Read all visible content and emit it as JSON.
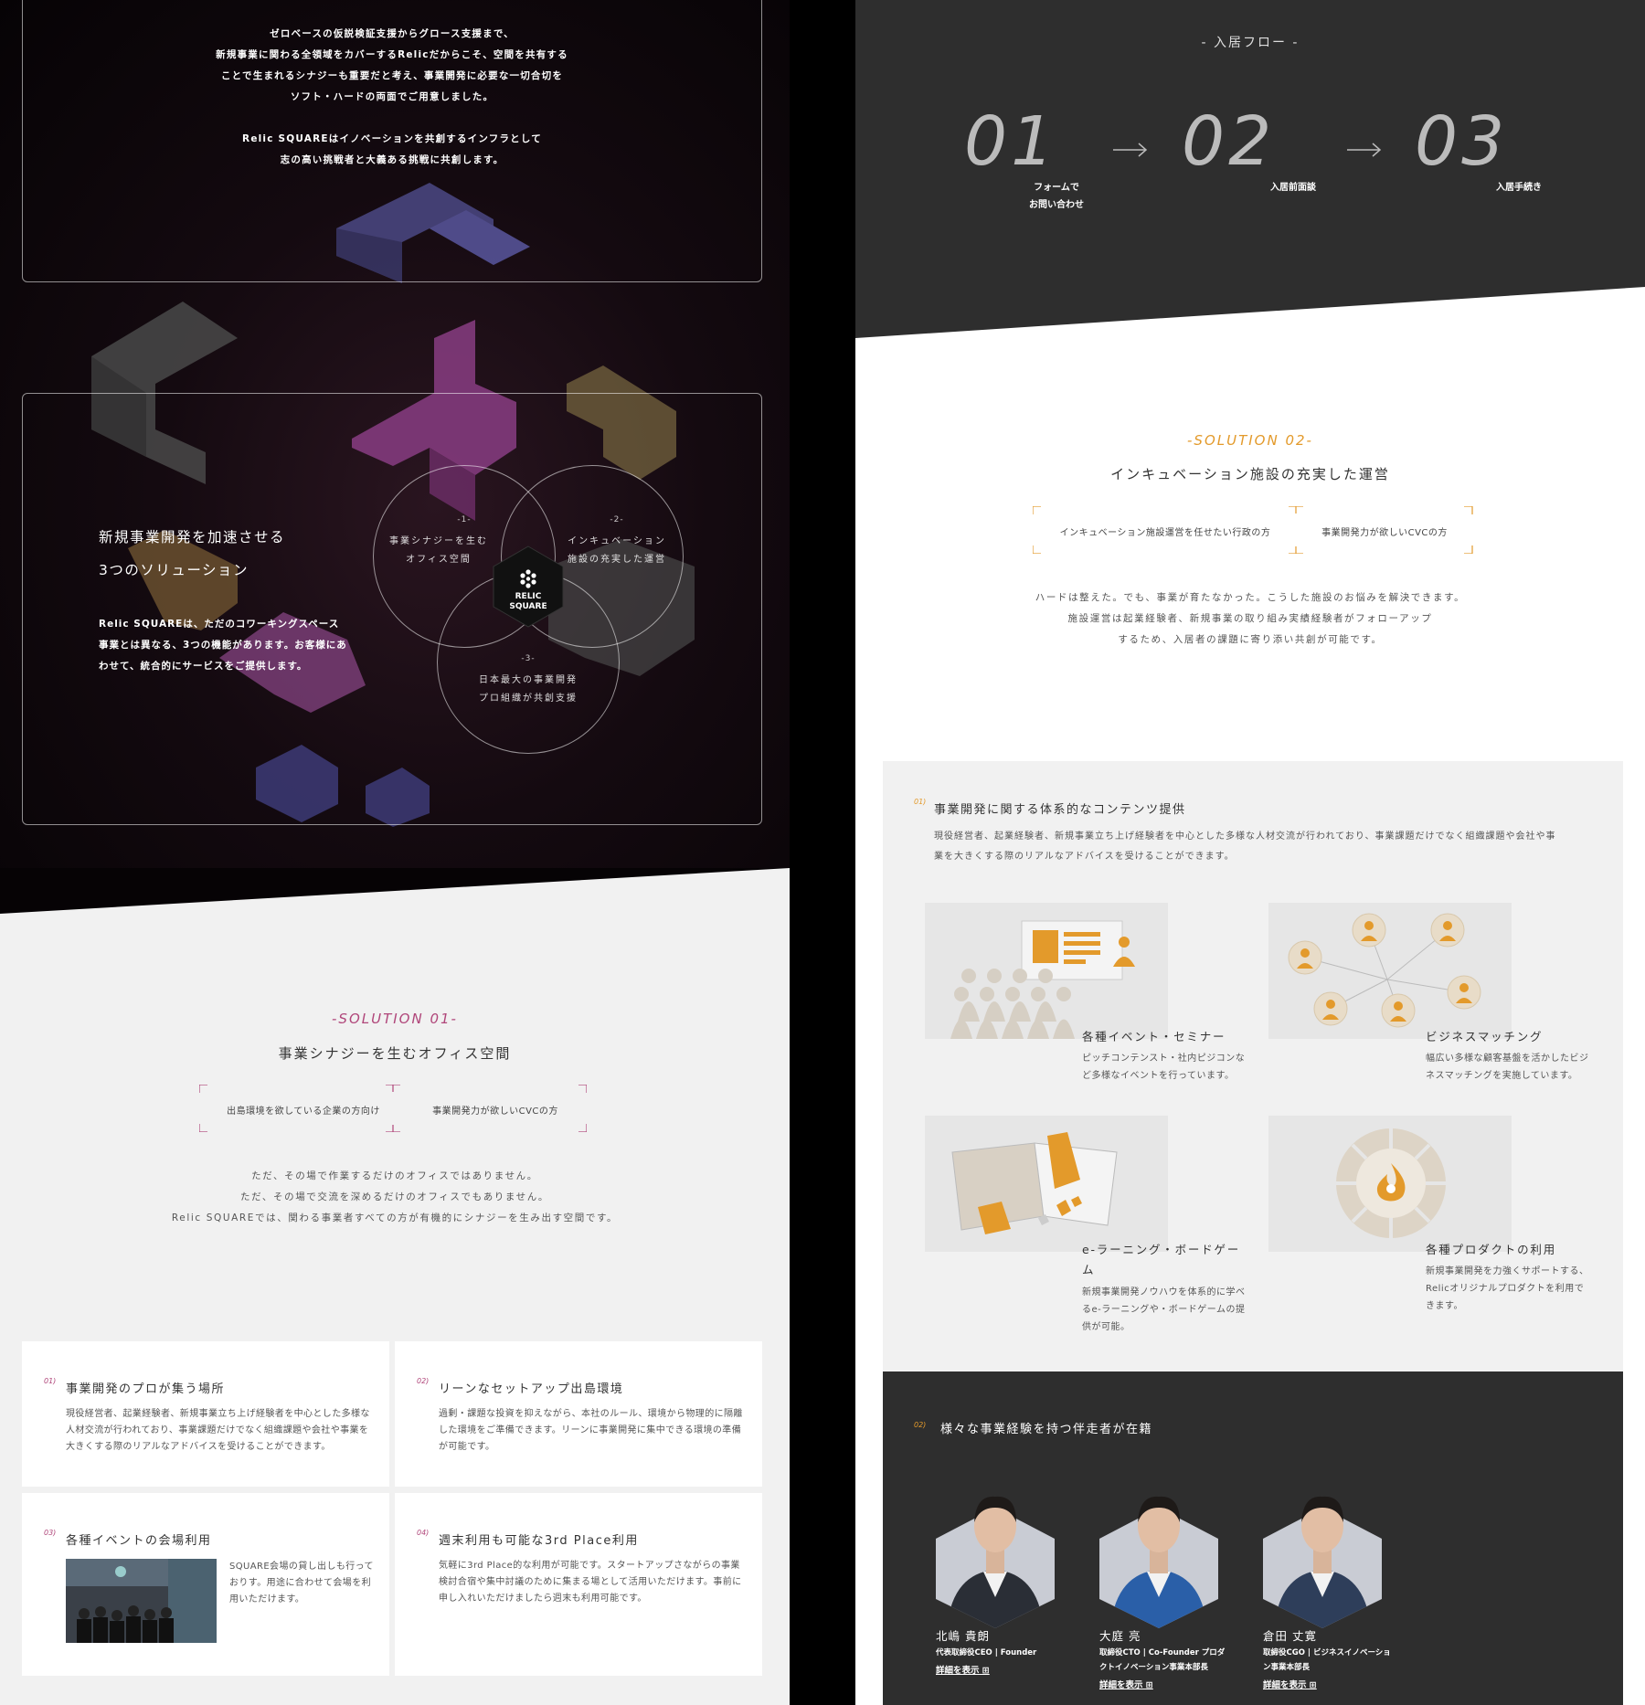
{
  "intro": {
    "lines": [
      "ゼロベースの仮説検証支援からグロース支援まで、",
      "新規事業に関わる全領域をカバーするRelicだからこそ、空間を共有する",
      "ことで生まれるシナジーも重要だと考え、事業開発に必要な一切合切を",
      "ソフト・ハードの両面でご用意しました。",
      "Relic SQUAREはイノベーションを共創するインフラとして",
      "志の高い挑戦者と大義ある挑戦に共創します。"
    ]
  },
  "solutions_overview": {
    "title_line1": "新規事業開発を加速させる",
    "title_line2": "3つのソリューション",
    "desc": "Relic SQUAREは、ただのコワーキングスペース事業とは異なる、3つの機能があります。お客様にあわせて、統合的にサービスをご提供します。",
    "circles": [
      {
        "num": "-1-",
        "line1": "事業シナジーを生む",
        "line2": "オフィス空間"
      },
      {
        "num": "-2-",
        "line1": "インキュベーション",
        "line2": "施設の充実した運営"
      },
      {
        "num": "-3-",
        "line1": "日本最大の事業開発",
        "line2": "プロ組織が共創支援"
      }
    ],
    "logo_line1": "RELIC",
    "logo_line2": "SQUARE"
  },
  "solution01": {
    "label": "-SOLUTION 01-",
    "heading": "事業シナジーを生むオフィス空間",
    "target_left": "出島環境を欲している企業の方向け",
    "target_right": "事業開発力が欲しいCVCの方",
    "para": [
      "ただ、その場で作業するだけのオフィスではありません。",
      "ただ、その場で交流を深めるだけのオフィスでもありません。",
      "Relic SQUAREでは、関わる事業者すべての方が有機的にシナジーを生み出す空間です。"
    ],
    "accent": "#b0467a",
    "cards": [
      {
        "num": "01)",
        "title": "事業開発のプロが集う場所",
        "text": "現役経営者、起業経験者、新規事業立ち上げ経験者を中心とした多様な人材交流が行われており、事業課題だけでなく組織課題や会社や事業を大きくする際のリアルなアドバイスを受けることができます。"
      },
      {
        "num": "02)",
        "title": "リーンなセットアップ出島環境",
        "text": "過剰・課題な投資を抑えながら、本社のルール、環境から物理的に隔離した環境をご準備できます。リーンに事業開発に集中できる環境の準備が可能です。"
      },
      {
        "num": "03)",
        "title": "各種イベントの会場利用",
        "text": "SQUARE会場の貸し出しも行っておりす。用途に合わせて会場を利用いただけます。"
      },
      {
        "num": "04)",
        "title": "週末利用も可能な3rd Place利用",
        "text": "気軽に3rd Place的な利用が可能です。スタートアップさながらの事業検討合宿や集中討議のために集まる場として活用いただけます。事前に申し入れいただけましたら週末も利用可能です。"
      }
    ]
  },
  "flow": {
    "title": "- 入居フロー -",
    "steps": [
      {
        "num": "01",
        "line1": "フォームで",
        "line2": "お問い合わせ"
      },
      {
        "num": "02",
        "line1": "入居前面談",
        "line2": ""
      },
      {
        "num": "03",
        "line1": "入居手続き",
        "line2": ""
      }
    ]
  },
  "solution02": {
    "label": "-SOLUTION 02-",
    "heading": "インキュベーション施設の充実した運営",
    "target_left": "インキュベーション施設運営を任せたい行政の方",
    "target_right": "事業開発力が欲しいCVCの方",
    "para": [
      "ハードは整えた。でも、事業が育たなかった。こうした施設のお悩みを解決できます。",
      "施設運営は起業経験者、新規事業の取り組み実績経験者がフォローアップ",
      "するため、入居者の課題に寄り添い共創が可能です。"
    ],
    "accent": "#e39a2b"
  },
  "contents": {
    "num": "01)",
    "title": "事業開発に関する体系的なコンテンツ提供",
    "text": "現役経営者、起業経験者、新規事業立ち上げ経験者を中心とした多様な人材交流が行われており、事業課題だけでなく組織課題や会社や事業を大きくする際のリアルなアドバイスを受けることができます。",
    "items": [
      {
        "title": "各種イベント・セミナー",
        "text": "ピッチコンテンスト・社内ピジコンなど多様なイベントを行っています。"
      },
      {
        "title": "ビジネスマッチング",
        "text": "幅広い多様な顧客基盤を活かしたビジネスマッチングを実施しています。"
      },
      {
        "title": "e-ラーニング・ボードゲーム",
        "text": "新規事業開発ノウハウを体系的に学べるe-ラーニングや・ボードゲームの提供が可能。"
      },
      {
        "title": "各種プロダクトの利用",
        "text": "新規事業開発を力強くサポートする、Relicオリジナルプロダクトを利用できます。"
      }
    ]
  },
  "partners": {
    "num": "02)",
    "title": "様々な事業経験を持つ伴走者が在籍",
    "people": [
      {
        "name": "北嶋 貴朗",
        "role": "代表取締役CEO | Founder",
        "link": "詳細を表示 ⊞",
        "shirt": "#2a2e36"
      },
      {
        "name": "大庭 亮",
        "role": "取締役CTO | Co-Founder プロダクトイノベーション事業本部長",
        "link": "詳細を表示 ⊞",
        "shirt": "#2a5fa8"
      },
      {
        "name": "倉田 丈寛",
        "role": "取締役CGO | ビジネスイノベーション事業本部長",
        "link": "詳細を表示 ⊞",
        "shirt": "#2e3e5a"
      }
    ]
  },
  "colors": {
    "orange": "#e39a2b",
    "magenta": "#b0467a",
    "dark": "#2e2e2e",
    "light": "#f1f1f1"
  }
}
